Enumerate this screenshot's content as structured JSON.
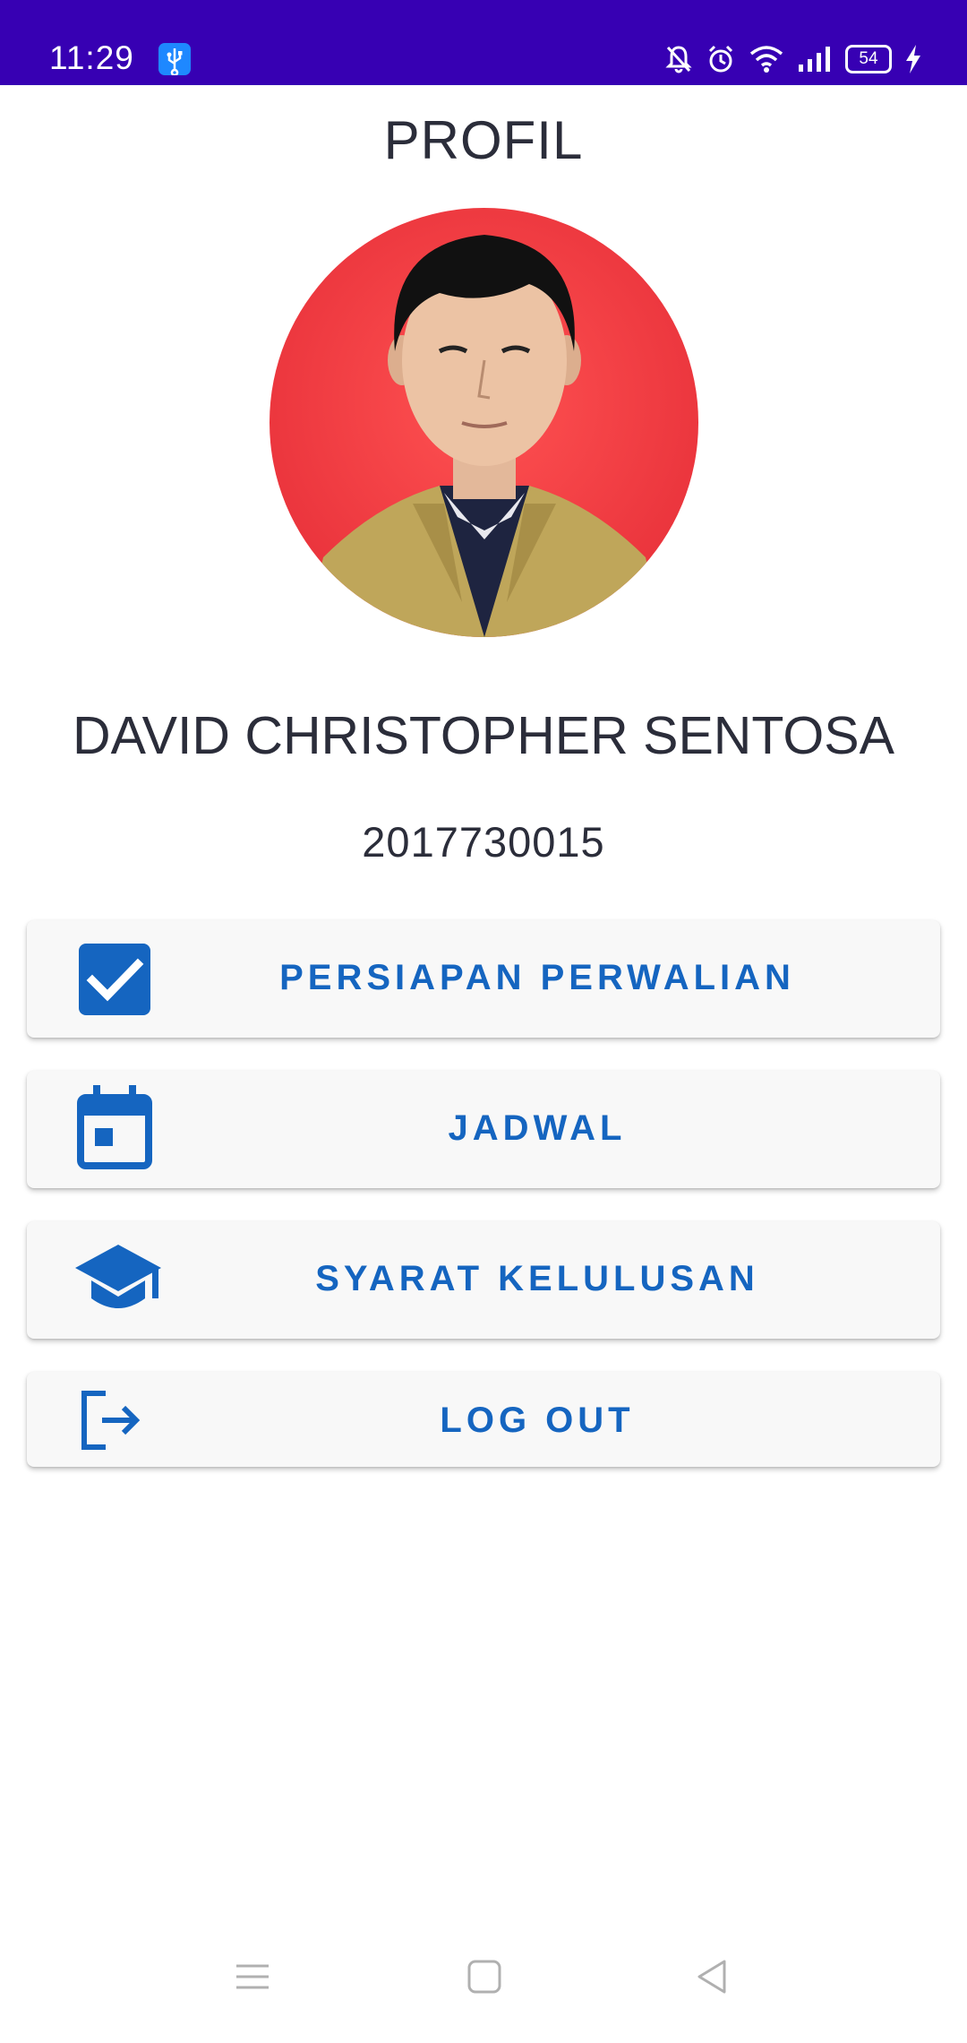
{
  "status_bar": {
    "time": "11:29",
    "battery_level": "54",
    "background_color": "#3700b3",
    "icons": [
      "usb-icon",
      "mute-icon",
      "alarm-icon",
      "wifi-icon",
      "signal-icon",
      "battery-icon",
      "charging-icon"
    ]
  },
  "header": {
    "title": "PROFIL"
  },
  "profile": {
    "name": "DAVID CHRISTOPHER SENTOSA",
    "student_id": "2017730015"
  },
  "menu": {
    "accent_color": "#1565c0",
    "items": [
      {
        "label": "PERSIAPAN PERWALIAN",
        "icon": "checkbox-icon"
      },
      {
        "label": "JADWAL",
        "icon": "calendar-icon"
      },
      {
        "label": "SYARAT KELULUSAN",
        "icon": "graduation-cap-icon"
      },
      {
        "label": "LOG OUT",
        "icon": "logout-icon"
      }
    ]
  },
  "nav_bar": {
    "icons": [
      "menu-icon",
      "home-icon",
      "back-icon"
    ]
  }
}
